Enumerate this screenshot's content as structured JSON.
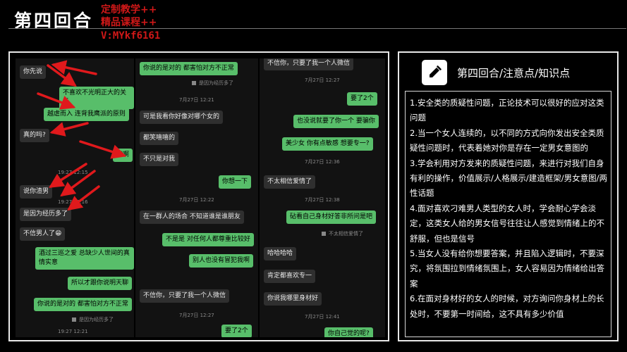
{
  "header": {
    "title": "第四回合",
    "watermark": [
      "定制教学++",
      "精品课程++",
      "V:MYkf6161"
    ]
  },
  "chat": {
    "col1": {
      "bubbles": [
        "你先说",
        "不喜欢不光明正大的关系",
        "越虐而入 连背我鹰派的原则",
        "真的吗?",
        "还啊",
        "说你渣男",
        "是因为经历多了",
        "不信男人了😁",
        "酒过三巡之爱 总缺少人世间的真情实意",
        "所以才跟你说明天聊",
        "你说的是对的 都害怕对方不正常"
      ],
      "times": [
        "19:27 12:15",
        "19:27 12:16",
        "19:27 12:21"
      ],
      "notes": [
        "是因为经历多了"
      ]
    },
    "col2": {
      "bubbles": [
        "你说的是对的 都害怕对方不正常",
        "可是我看你好像对哪个女的",
        "都笑嘻嘻的",
        "不只是对我",
        "你想一下",
        "在一群人的场合 不知道谁是谁朋友",
        "不是是 对任何人都尊重比较好",
        "别人也没有冒犯我啊",
        "不信你，只要了我一个人微信",
        "要了2个"
      ],
      "times": [
        "7月27日 12:21",
        "7月27日 12:22",
        "7月27日 12:27"
      ],
      "notes": [
        "是因为经历多了"
      ]
    },
    "col3": {
      "bubbles": [
        "不信你，只要了我一个人微信",
        "要了2个",
        "也没说就要了你一个 要骗你",
        "美少女 你有点敏感 想要专一?",
        "不太相信爱情了",
        "砧看自己身材好答非所问是吧",
        "哈哈哈哈",
        "肯定都喜欢专一",
        "你说我哪里身材好",
        "你自己觉的呢?"
      ],
      "times": [
        "7月27日 12:27",
        "7月27日 12:36",
        "7月27日 12:38",
        "7月27日 12:41"
      ],
      "notes": [
        "不太相信爱情了"
      ]
    }
  },
  "panel": {
    "heading": "第四回合/注意点/知识点",
    "icon": "pencil-icon",
    "points": [
      "1.安全类的质疑性问题，正论技术可以很好的应对这类问题",
      "2.当一个女人连续的，以不同的方式向你发出安全类质疑性问题时，代表着她对你是存在一定男女意图的",
      "3.学会利用对方发来的质疑性问题，来进行对我们自身有利的操作，价值展示/人格展示/建造框架/男女意图/两性话题",
      "4.面对喜欢刁难男人类型的女人时，学会耐心学会淡定，这类女人给的男女信号往往让人感觉到情绪上的不舒服，但也是信号",
      "5.当女人没有给你想要答案，并且陷入逻辑时，不要深究，将氛围拉到情绪氛围上，女人容易因为情绪给出答案",
      "6.在面对身材好的女人的时候，对方询问你身材上的长处时，不要第一时间给，这不具有多少价值"
    ]
  },
  "colors": {
    "accent_red": "#d01818",
    "bubble_green": "#58be6a",
    "bubble_gray": "#2f2f2f",
    "arrow_red": "#e0191c"
  }
}
